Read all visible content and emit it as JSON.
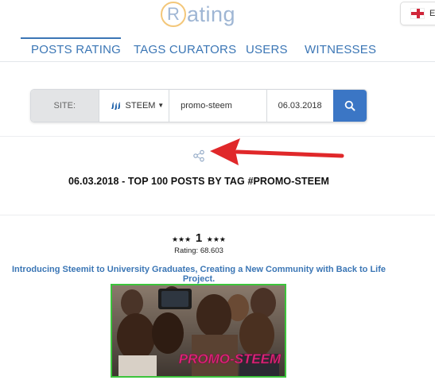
{
  "header": {
    "logo_letter": "R",
    "logo_text": "ating",
    "lang_label": "E"
  },
  "nav": {
    "items": [
      {
        "label": "POSTS RATING",
        "active": true
      },
      {
        "label": "TAGS CURATORS",
        "active": false
      },
      {
        "label": "USERS",
        "active": false
      },
      {
        "label": "WITNESSES",
        "active": false
      }
    ]
  },
  "search": {
    "site_label": "SITE:",
    "site_value": "STEEM",
    "tag_value": "promo-steem",
    "date_value": "06.03.2018"
  },
  "main": {
    "heading": "06.03.2018 - TOP 100 POSTS BY TAG #PROMO-STEEM"
  },
  "post": {
    "stars_left": "★★★",
    "rank": "1",
    "stars_right": "★★★",
    "rating": "Rating: 68.603",
    "title": "Introducing Steemit to University Graduates, Creating a New Community with Back to Life Project.",
    "image_caption": "PROMO-STEEM"
  },
  "colors": {
    "accent": "#3b76b5",
    "search_button": "#3b76c5",
    "arrow": "#e0282a",
    "thumb_border": "#3cc43c",
    "caption": "#e0287a"
  }
}
